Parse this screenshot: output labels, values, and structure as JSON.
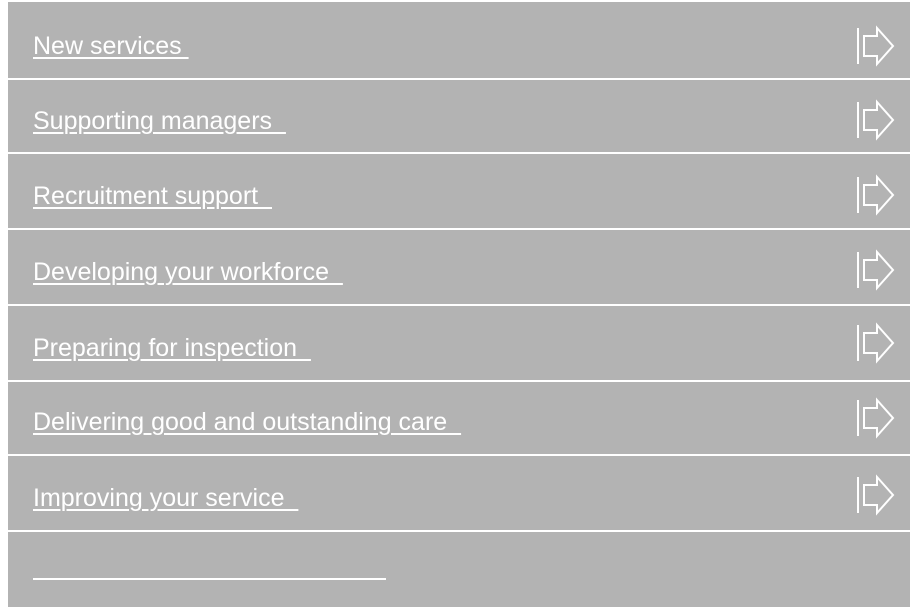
{
  "menu": {
    "items": [
      {
        "label": "New services ",
        "icon": "arrow-right-icon"
      },
      {
        "label": "Supporting managers  ",
        "icon": "arrow-right-icon"
      },
      {
        "label": "Recruitment support  ",
        "icon": "arrow-right-icon"
      },
      {
        "label": "Developing your workforce  ",
        "icon": "arrow-right-icon"
      },
      {
        "label": "Preparing for inspection  ",
        "icon": "arrow-right-icon"
      },
      {
        "label": "Delivering good and outstanding care  ",
        "icon": "arrow-right-icon"
      },
      {
        "label": "Improving your service  ",
        "icon": "arrow-right-icon"
      }
    ]
  },
  "colors": {
    "background": "#b3b3b3",
    "text": "#ffffff",
    "divider": "#ffffff"
  }
}
